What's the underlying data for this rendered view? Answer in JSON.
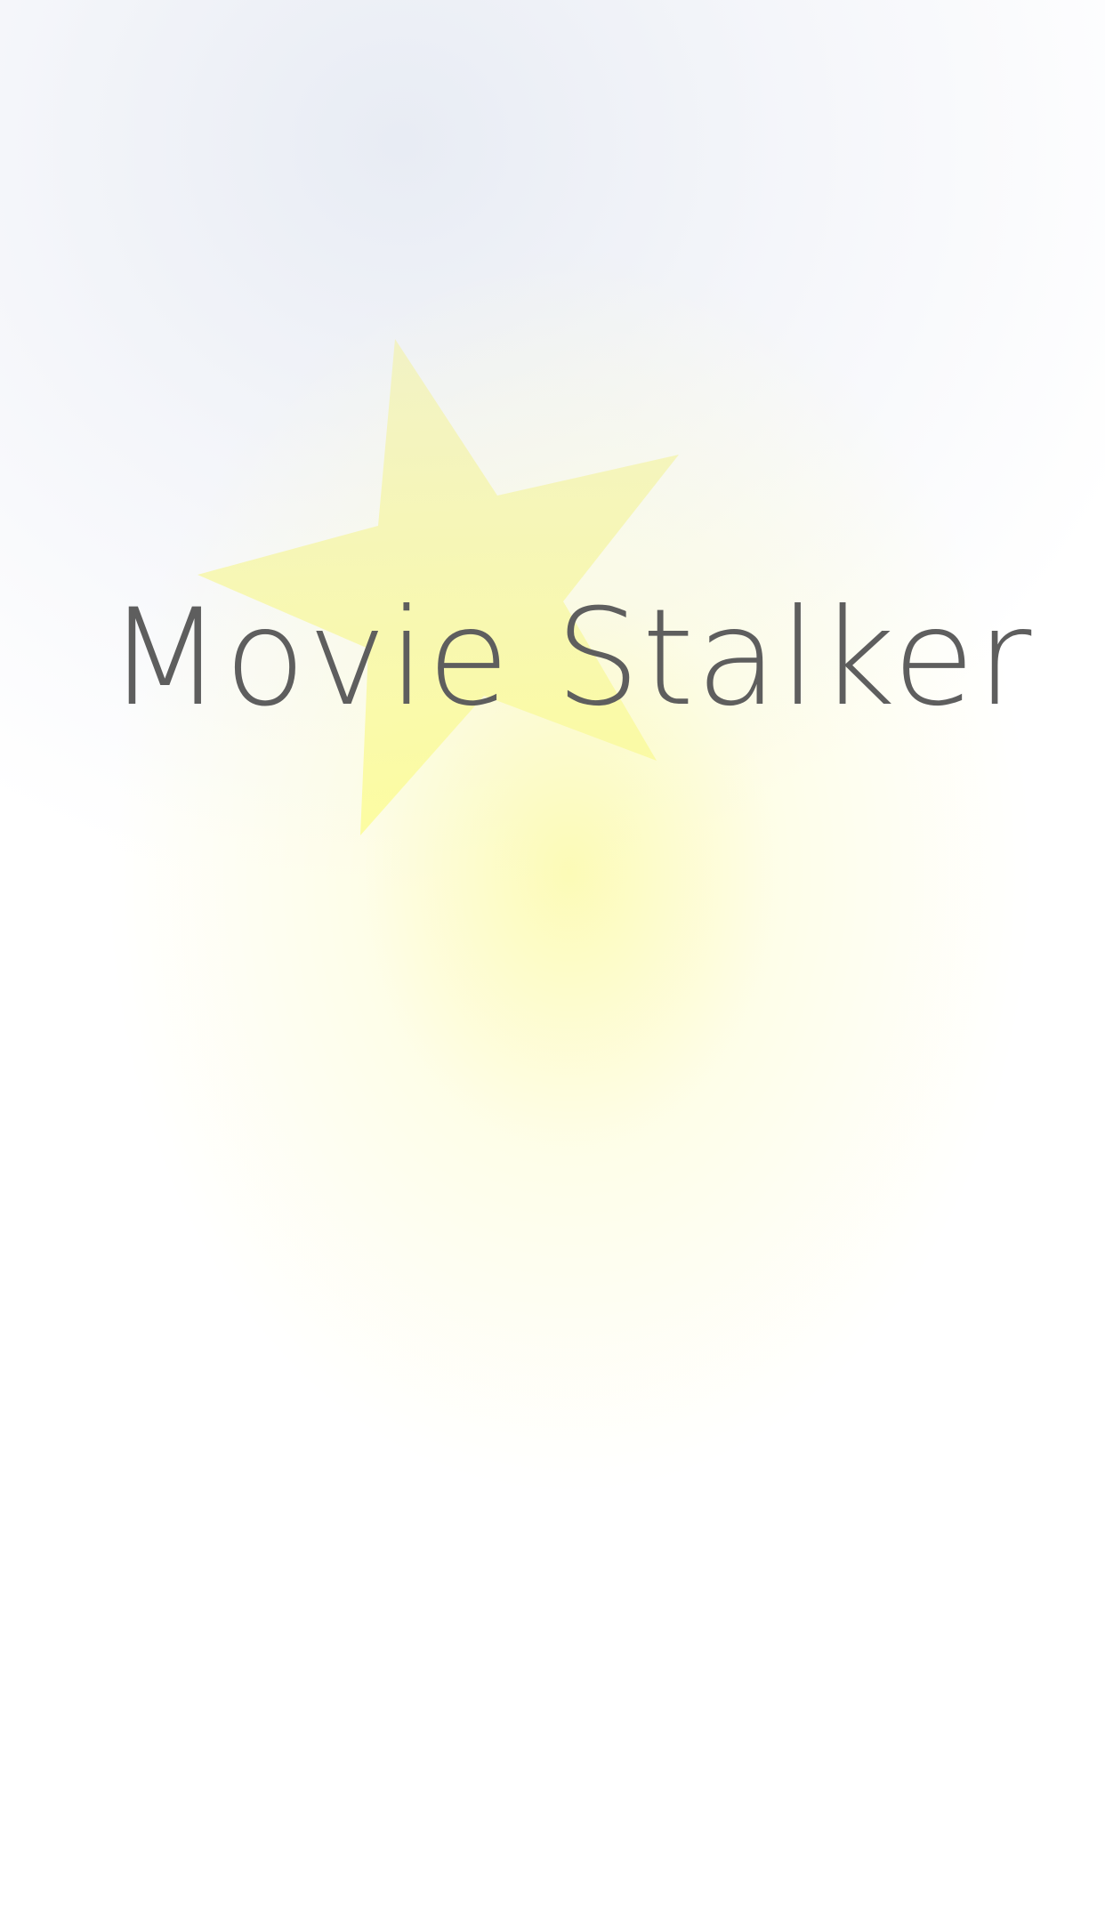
{
  "splash": {
    "app_title": "Movie Stalker",
    "logo_icon": "star-icon",
    "colors": {
      "star": "#fbfa9c",
      "title_text": "#5e5e5e",
      "background_top": "#e8ecf4",
      "background_glow": "#fcfaaa"
    }
  }
}
